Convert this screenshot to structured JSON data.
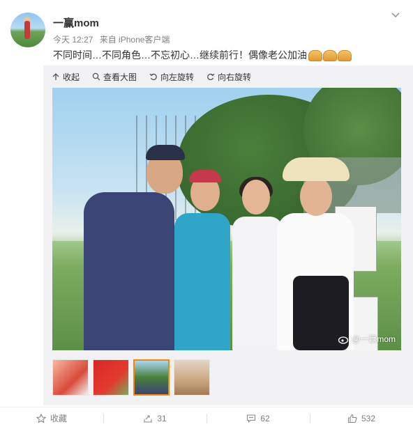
{
  "post": {
    "username": "一赢mom",
    "time": "今天 12:27",
    "source": "来自 iPhone客户端",
    "text": "不同时间…不同角色…不忘初心…继续前行！偶像老公加油"
  },
  "toolbar": {
    "collapse_label": "收起",
    "view_large_label": "查看大图",
    "rotate_left_label": "向左旋转",
    "rotate_right_label": "向右旋转"
  },
  "image": {
    "watermark": "@一赢mom"
  },
  "thumbnails": {
    "count": 4,
    "active_index": 2
  },
  "actions": {
    "favorite_label": "收藏",
    "repost_count": "31",
    "comment_count": "62",
    "like_count": "532"
  },
  "icons": [
    "chevron-down-icon",
    "collapse-icon",
    "search-icon",
    "rotate-left-icon",
    "rotate-right-icon",
    "weibo-logo-icon",
    "star-icon",
    "repost-icon",
    "comment-icon",
    "like-icon"
  ],
  "colors": {
    "accent": "#ff8200",
    "text": "#333333",
    "meta": "#808080",
    "media_bg": "#f2f2f5"
  }
}
